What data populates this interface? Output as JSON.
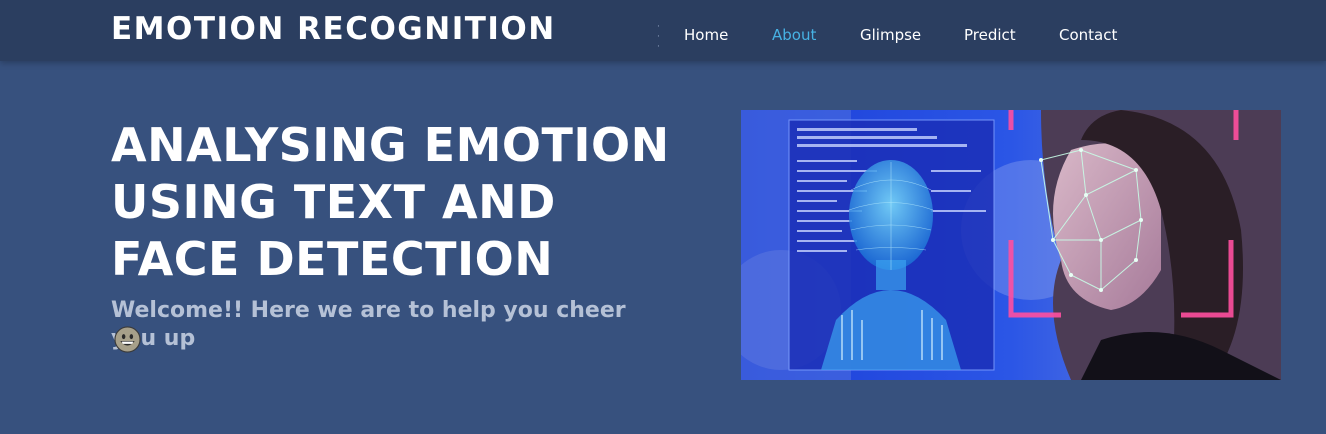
{
  "header": {
    "logo": "EMOTION RECOGNITION",
    "nav": [
      {
        "label": "Home",
        "active": false
      },
      {
        "label": "About",
        "active": true
      },
      {
        "label": "Glimpse",
        "active": false
      },
      {
        "label": "Predict",
        "active": false
      },
      {
        "label": "Contact",
        "active": false
      }
    ]
  },
  "hero": {
    "title_lines": [
      "ANALYSING EMOTION",
      "USING TEXT AND",
      "FACE DETECTION"
    ],
    "subtitle": "Welcome!! Here we are to help you cheer you up",
    "emoji": "grinning-face"
  },
  "colors": {
    "background": "#37517e",
    "header": "#2b3e60",
    "active_link": "#47b2e4",
    "subtitle": "#b5c1d6"
  }
}
